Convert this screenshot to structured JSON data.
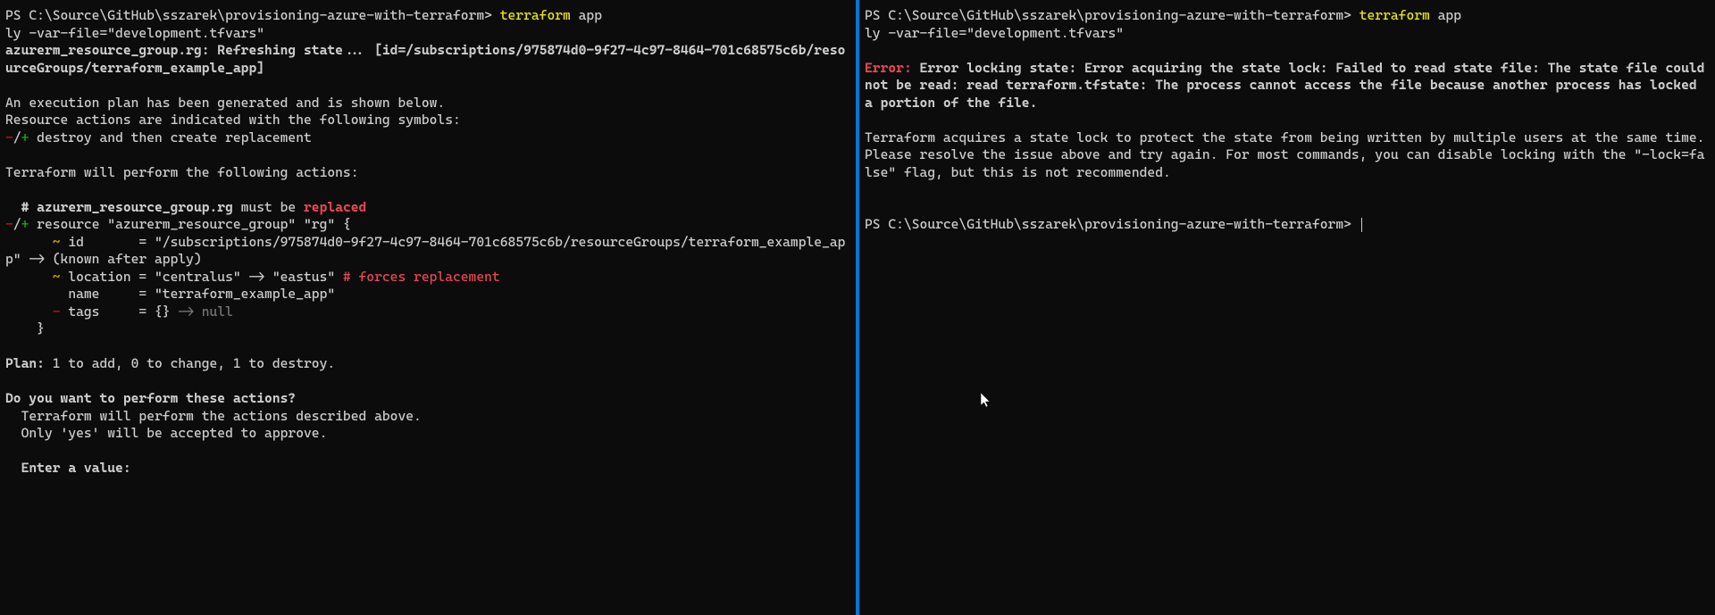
{
  "left": {
    "prompt_prefix": "PS C:\\Source\\GitHub\\sszarek\\provisioning-azure-with-terraform> ",
    "cmd_part1": "terraform",
    "cmd_part2": " app",
    "cmd_line2": "ly -var-file=\"development.tfvars\"",
    "refresh_line": "azurerm_resource_group.rg: Refreshing state... [id=/subscriptions/975874d0-9f27-4c97-8464-701c68575c6b/resourceGroups/terraform_example_app]",
    "plan_intro1": "An execution plan has been generated and is shown below.",
    "plan_intro2": "Resource actions are indicated with the following symbols:",
    "symbol_minus": "-",
    "symbol_slash": "/",
    "symbol_plus": "+",
    "symbol_desc": " destroy and then create replacement",
    "actions_intro": "Terraform will perform the following actions:",
    "comment_prefix": "  # azurerm_resource_group.rg",
    "comment_mustbe": " must be ",
    "comment_replaced": "replaced",
    "res_prefix_minus": "-",
    "res_prefix_slash": "/",
    "res_prefix_plus": "+",
    "res_decl": " resource \"azurerm_resource_group\" \"rg\" {",
    "id_tilde": "      ~ ",
    "id_text": "id       = \"/subscriptions/975874d0-9f27-4c97-8464-701c68575c6b/resourceGroups/terraform_example_app\"",
    "id_arrow": " -> ",
    "id_known": "(known after apply)",
    "loc_tilde": "      ~ ",
    "loc_text": "location = \"centralus\" -> \"eastus\"",
    "loc_forces": " # forces replacement",
    "name_text": "        name     = \"terraform_example_app\"",
    "tags_minus": "      - ",
    "tags_text": "tags     = {}",
    "tags_arrow": " -> ",
    "tags_null": "null",
    "close_brace": "    }",
    "plan_summary": "Plan:",
    "plan_summary_rest": " 1 to add, 0 to change, 1 to destroy.",
    "confirm_q": "Do you want to perform these actions?",
    "confirm_l1": "  Terraform will perform the actions described above.",
    "confirm_l2": "  Only 'yes' will be accepted to approve.",
    "enter_val": "  Enter a value:"
  },
  "right": {
    "prompt_prefix": "PS C:\\Source\\GitHub\\sszarek\\provisioning-azure-with-terraform> ",
    "cmd_part1": "terraform",
    "cmd_part2": " app",
    "cmd_line2": "ly -var-file=\"development.tfvars\"",
    "error_label": "Error:",
    "error_msg": " Error locking state: Error acquiring the state lock: Failed to read state file: The state file could not be read: read terraform.tfstate: The process cannot access the file because another process has locked a portion of the file.",
    "explain": "Terraform acquires a state lock to protect the state from being written by multiple users at the same time. Please resolve the issue above and try again. For most commands, you can disable locking with the \"-lock=false\" flag, but this is not recommended.",
    "prompt2": "PS C:\\Source\\GitHub\\sszarek\\provisioning-azure-with-terraform> "
  }
}
